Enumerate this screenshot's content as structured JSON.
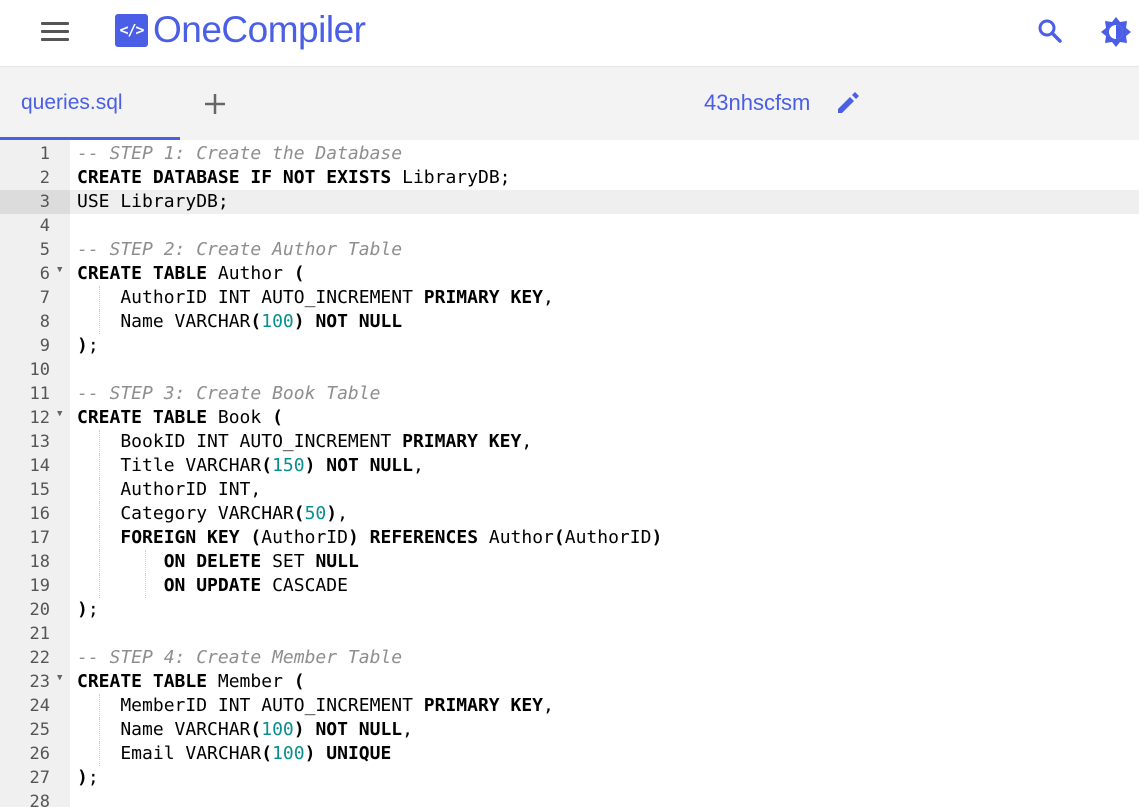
{
  "app": {
    "brand": "OneCompiler",
    "logo_glyph": "</>",
    "accent": "#4a5ee6"
  },
  "header": {
    "menu_icon": "hamburger-menu-icon",
    "search_icon": "search-icon",
    "theme_icon": "brightness-icon"
  },
  "tabs": {
    "active_file": "queries.sql",
    "add_icon": "plus-icon",
    "code_id": "43nhscfsm",
    "edit_icon": "pencil-icon"
  },
  "editor": {
    "active_line": 3,
    "lines": [
      {
        "n": "1",
        "fold": false,
        "guides": 0,
        "tokens": [
          [
            "cm",
            "-- STEP 1: Create the Database"
          ]
        ]
      },
      {
        "n": "2",
        "fold": false,
        "guides": 0,
        "tokens": [
          [
            "kw",
            "CREATE DATABASE IF NOT EXISTS"
          ],
          [
            "pl",
            " LibraryDB;"
          ]
        ]
      },
      {
        "n": "3",
        "fold": false,
        "guides": 0,
        "tokens": [
          [
            "pl",
            "USE LibraryDB;"
          ]
        ]
      },
      {
        "n": "4",
        "fold": false,
        "guides": 0,
        "tokens": []
      },
      {
        "n": "5",
        "fold": false,
        "guides": 0,
        "tokens": [
          [
            "cm",
            "-- STEP 2: Create Author Table"
          ]
        ]
      },
      {
        "n": "6",
        "fold": true,
        "guides": 0,
        "tokens": [
          [
            "kw",
            "CREATE TABLE"
          ],
          [
            "pl",
            " Author "
          ],
          [
            "kw",
            "("
          ]
        ]
      },
      {
        "n": "7",
        "fold": false,
        "guides": 1,
        "tokens": [
          [
            "pl",
            "    AuthorID INT AUTO_INCREMENT "
          ],
          [
            "kw",
            "PRIMARY KEY"
          ],
          [
            "pl",
            ","
          ]
        ]
      },
      {
        "n": "8",
        "fold": false,
        "guides": 1,
        "tokens": [
          [
            "pl",
            "    Name VARCHAR"
          ],
          [
            "kw",
            "("
          ],
          [
            "num",
            "100"
          ],
          [
            "kw",
            ")"
          ],
          [
            "pl",
            " "
          ],
          [
            "kw",
            "NOT NULL"
          ]
        ]
      },
      {
        "n": "9",
        "fold": false,
        "guides": 0,
        "tokens": [
          [
            "kw",
            ")"
          ],
          [
            "pl",
            ";"
          ]
        ]
      },
      {
        "n": "10",
        "fold": false,
        "guides": 0,
        "tokens": []
      },
      {
        "n": "11",
        "fold": false,
        "guides": 0,
        "tokens": [
          [
            "cm",
            "-- STEP 3: Create Book Table"
          ]
        ]
      },
      {
        "n": "12",
        "fold": true,
        "guides": 0,
        "tokens": [
          [
            "kw",
            "CREATE TABLE"
          ],
          [
            "pl",
            " Book "
          ],
          [
            "kw",
            "("
          ]
        ]
      },
      {
        "n": "13",
        "fold": false,
        "guides": 1,
        "tokens": [
          [
            "pl",
            "    BookID INT AUTO_INCREMENT "
          ],
          [
            "kw",
            "PRIMARY KEY"
          ],
          [
            "pl",
            ","
          ]
        ]
      },
      {
        "n": "14",
        "fold": false,
        "guides": 1,
        "tokens": [
          [
            "pl",
            "    Title VARCHAR"
          ],
          [
            "kw",
            "("
          ],
          [
            "num",
            "150"
          ],
          [
            "kw",
            ")"
          ],
          [
            "pl",
            " "
          ],
          [
            "kw",
            "NOT NULL"
          ],
          [
            "pl",
            ","
          ]
        ]
      },
      {
        "n": "15",
        "fold": false,
        "guides": 1,
        "tokens": [
          [
            "pl",
            "    AuthorID INT,"
          ]
        ]
      },
      {
        "n": "16",
        "fold": false,
        "guides": 1,
        "tokens": [
          [
            "pl",
            "    Category VARCHAR"
          ],
          [
            "kw",
            "("
          ],
          [
            "num",
            "50"
          ],
          [
            "kw",
            ")"
          ],
          [
            "pl",
            ","
          ]
        ]
      },
      {
        "n": "17",
        "fold": false,
        "guides": 1,
        "tokens": [
          [
            "pl",
            "    "
          ],
          [
            "kw",
            "FOREIGN KEY"
          ],
          [
            "pl",
            " "
          ],
          [
            "kw",
            "("
          ],
          [
            "pl",
            "AuthorID"
          ],
          [
            "kw",
            ")"
          ],
          [
            "pl",
            " "
          ],
          [
            "kw",
            "REFERENCES"
          ],
          [
            "pl",
            " Author"
          ],
          [
            "kw",
            "("
          ],
          [
            "pl",
            "AuthorID"
          ],
          [
            "kw",
            ")"
          ]
        ]
      },
      {
        "n": "18",
        "fold": false,
        "guides": 2,
        "tokens": [
          [
            "pl",
            "        "
          ],
          [
            "kw",
            "ON DELETE"
          ],
          [
            "pl",
            " SET "
          ],
          [
            "kw",
            "NULL"
          ]
        ]
      },
      {
        "n": "19",
        "fold": false,
        "guides": 2,
        "tokens": [
          [
            "pl",
            "        "
          ],
          [
            "kw",
            "ON UPDATE"
          ],
          [
            "pl",
            " CASCADE"
          ]
        ]
      },
      {
        "n": "20",
        "fold": false,
        "guides": 0,
        "tokens": [
          [
            "kw",
            ")"
          ],
          [
            "pl",
            ";"
          ]
        ]
      },
      {
        "n": "21",
        "fold": false,
        "guides": 0,
        "tokens": []
      },
      {
        "n": "22",
        "fold": false,
        "guides": 0,
        "tokens": [
          [
            "cm",
            "-- STEP 4: Create Member Table"
          ]
        ]
      },
      {
        "n": "23",
        "fold": true,
        "guides": 0,
        "tokens": [
          [
            "kw",
            "CREATE TABLE"
          ],
          [
            "pl",
            " Member "
          ],
          [
            "kw",
            "("
          ]
        ]
      },
      {
        "n": "24",
        "fold": false,
        "guides": 1,
        "tokens": [
          [
            "pl",
            "    MemberID INT AUTO_INCREMENT "
          ],
          [
            "kw",
            "PRIMARY KEY"
          ],
          [
            "pl",
            ","
          ]
        ]
      },
      {
        "n": "25",
        "fold": false,
        "guides": 1,
        "tokens": [
          [
            "pl",
            "    Name VARCHAR"
          ],
          [
            "kw",
            "("
          ],
          [
            "num",
            "100"
          ],
          [
            "kw",
            ")"
          ],
          [
            "pl",
            " "
          ],
          [
            "kw",
            "NOT NULL"
          ],
          [
            "pl",
            ","
          ]
        ]
      },
      {
        "n": "26",
        "fold": false,
        "guides": 1,
        "tokens": [
          [
            "pl",
            "    Email VARCHAR"
          ],
          [
            "kw",
            "("
          ],
          [
            "num",
            "100"
          ],
          [
            "kw",
            ")"
          ],
          [
            "pl",
            " "
          ],
          [
            "kw",
            "UNIQUE"
          ]
        ]
      },
      {
        "n": "27",
        "fold": false,
        "guides": 0,
        "tokens": [
          [
            "kw",
            ")"
          ],
          [
            "pl",
            ";"
          ]
        ]
      },
      {
        "n": "28",
        "fold": false,
        "guides": 0,
        "tokens": []
      }
    ]
  }
}
